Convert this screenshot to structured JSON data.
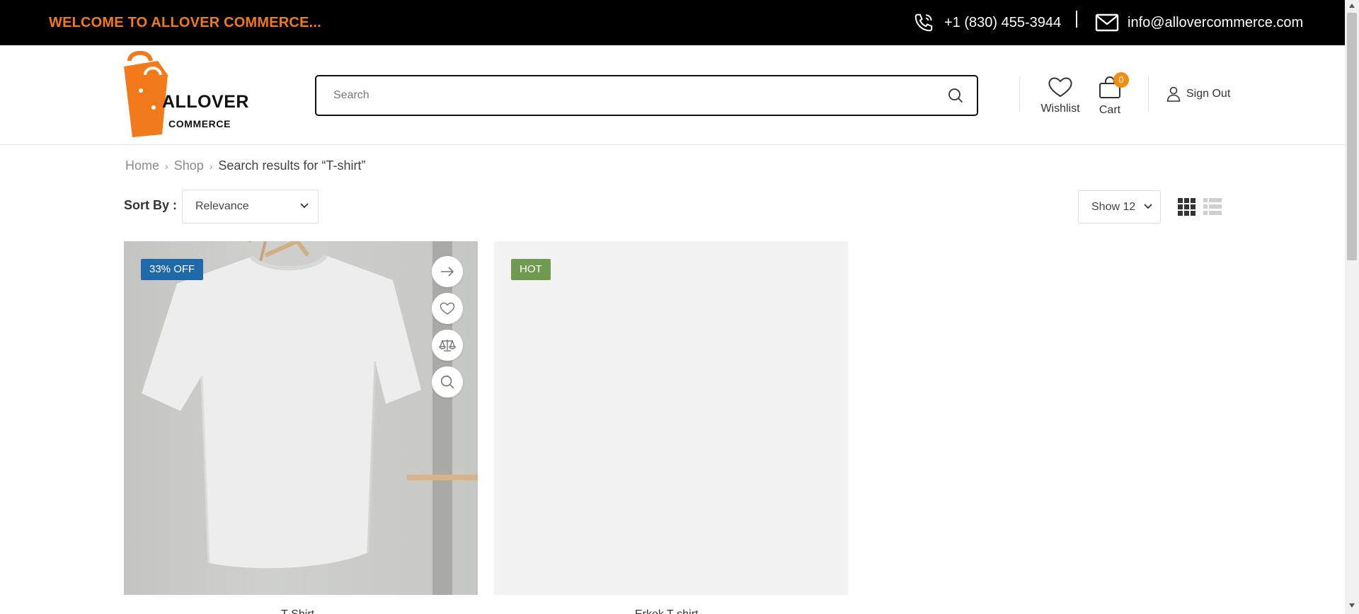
{
  "topbar": {
    "welcome": "WELCOME TO ALLOVER COMMERCE...",
    "phone": "+1 (830) 455-3944",
    "email": "info@allovercommerce.com"
  },
  "logo": {
    "word1": "ALLOVER",
    "word2": "COMMERCE",
    "brand_color": "#f27a1a"
  },
  "search": {
    "placeholder": "Search",
    "value": ""
  },
  "header": {
    "wishlist_label": "Wishlist",
    "cart_label": "Cart",
    "cart_count": "0",
    "signout_label": "Sign Out"
  },
  "breadcrumb": {
    "items": [
      "Home",
      "Shop"
    ],
    "current": "Search results for “T-shirt”"
  },
  "toolbar": {
    "sort_label": "Sort By :",
    "sort_value": "Relevance",
    "show_value": "Show 12"
  },
  "products": [
    {
      "badge": "33% OFF",
      "badge_color": "#2069a8",
      "title": "T-Shirt"
    },
    {
      "badge": "HOT",
      "badge_color": "#6f9a4f",
      "title": "Erkek T-shirt"
    }
  ],
  "icons": [
    "phone-icon",
    "mail-icon",
    "search-icon",
    "heart-icon",
    "bag-icon",
    "user-icon",
    "chevron-right-icon",
    "chevron-down-icon",
    "grid-view-icon",
    "list-view-icon",
    "arrow-right-icon",
    "compare-icon",
    "zoom-icon"
  ]
}
